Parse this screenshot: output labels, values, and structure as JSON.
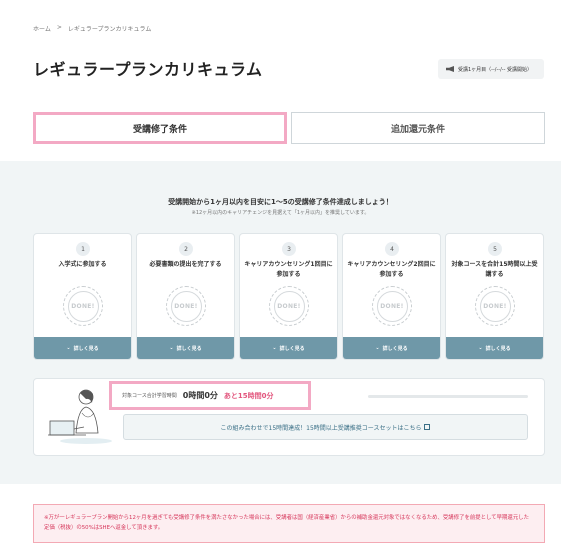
{
  "breadcrumb": {
    "home": "ホーム",
    "sep": ">",
    "current": "レギュラープランカリキュラム"
  },
  "page_title": "レギュラープランカリキュラム",
  "badge": {
    "icon": "megaphone-icon",
    "text": "受講1ヶ月目（--/--/-- 受講開始）"
  },
  "tabs": [
    {
      "label": "受講修了条件",
      "active": true
    },
    {
      "label": "追加還元条件",
      "active": false
    }
  ],
  "intro": {
    "title": "受講開始から1ヶ月以内を目安に1〜5の受講修了条件達成しましょう！",
    "subtitle": "※12ヶ月以内のキャリアチェンジを見据えて「1ヶ月以内」を推奨しています。"
  },
  "steps": [
    {
      "num": "1",
      "label": "入学式に参加する",
      "stamp": "DONE!",
      "detail": "詳しく見る"
    },
    {
      "num": "2",
      "label": "必要書類の提出を完了する",
      "stamp": "DONE!",
      "detail": "詳しく見る"
    },
    {
      "num": "3",
      "label": "キャリアカウンセリング1回目に参加する",
      "stamp": "DONE!",
      "detail": "詳しく見る"
    },
    {
      "num": "4",
      "label": "キャリアカウンセリング2回目に参加する",
      "stamp": "DONE!",
      "detail": "詳しく見る"
    },
    {
      "num": "5",
      "label": "対象コースを合計15時間以上受講する",
      "stamp": "DONE!",
      "detail": "詳しく見る"
    }
  ],
  "progress": {
    "label": "対象コース合計学習時間",
    "value": "0時間0分",
    "remaining": "あと15時間0分",
    "fraction": 0,
    "link_text": "この組み合わせで15時間達成！15時間以上受講推奨コースセットはこちら"
  },
  "notice": "※万が一レギュラープラン開始から12ヶ月を過ぎても受講修了条件を満たさなかった場合には、受講者は国（経済産業省）からの補助金還元対象ではなくなるため、受講修了を前提として早期還元した定価（税抜）の50%はSHEへ返金して頂きます。",
  "colors": {
    "accent_pink": "#f3a9c4",
    "teal": "#6f98a8",
    "alert_red": "#d6365a",
    "band_bg": "#f1f5f6"
  }
}
